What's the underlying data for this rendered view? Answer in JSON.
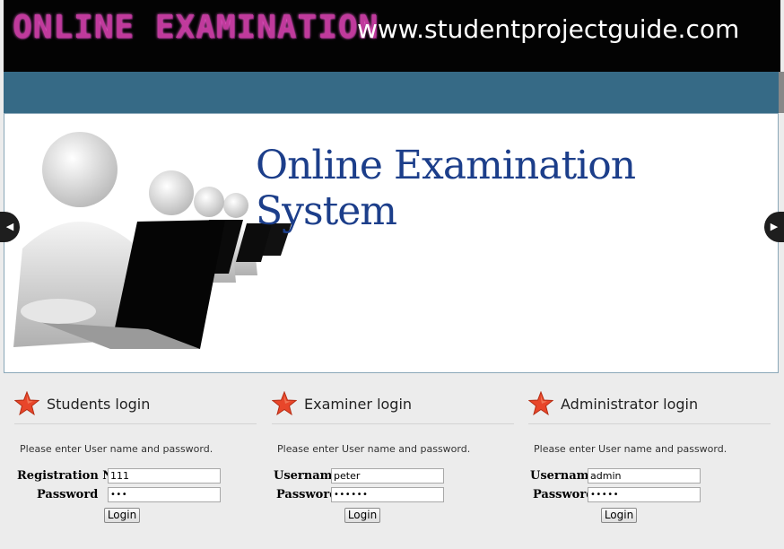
{
  "header": {
    "logo_text": "ONLINE EXAMINATION",
    "site_url": "www.studentprojectguide.com"
  },
  "slider": {
    "title": "Online Examination System",
    "prev_icon": "◀",
    "next_icon": "▶"
  },
  "students": {
    "title": "Students login",
    "note": "Please enter User name and password.",
    "user_label": "Registration No.",
    "user_value": "111",
    "password_label": "Password",
    "password_value": "•••",
    "button": "Login"
  },
  "examiner": {
    "title": "Examiner login",
    "note": "Please enter User name and password.",
    "user_label": "Username",
    "user_value": "peter",
    "password_label": "Password",
    "password_value": "••••••",
    "button": "Login"
  },
  "admin": {
    "title": "Administrator login",
    "note": "Please enter User name and password.",
    "user_label": "Username",
    "user_value": "admin",
    "password_label": "Password",
    "password_value": "•••••",
    "button": "Login"
  },
  "colors": {
    "navbar": "#366a86",
    "title_blue": "#1c3e8a",
    "logo_pink": "#c03a9c",
    "star_red": "#e8462a"
  }
}
